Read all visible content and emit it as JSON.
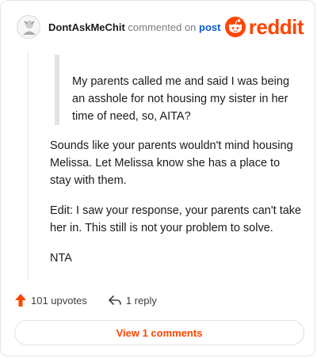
{
  "comment": {
    "username": "DontAskMeChit",
    "action_text": "commented on",
    "post_link": "post",
    "brand": "reddit",
    "quote": "My parents called me and said I was being an asshole for not housing my sister in her time of need, so, AITA?",
    "paragraphs": [
      "Sounds like your parents wouldn't mind housing Melissa. Let Melissa know she has a place to stay with them.",
      "Edit: I saw your response, your parents can't take her in. This still is not your problem to solve.",
      "NTA"
    ],
    "upvotes": "101 upvotes",
    "replies": "1 reply",
    "view_button": "View 1 comments"
  },
  "colors": {
    "brand": "#ff4500",
    "link": "#0b5bd3",
    "text": "#1a1a1b",
    "muted": "#7c7c7c"
  },
  "icons": [
    "avatar-icon",
    "reddit-snoo-icon",
    "upvote-arrow-icon",
    "reply-icon"
  ]
}
